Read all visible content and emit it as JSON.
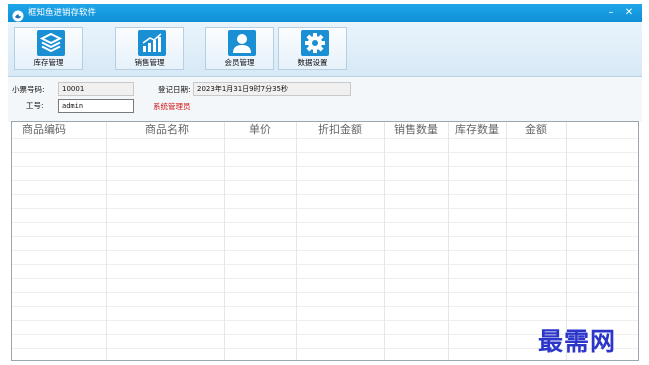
{
  "window": {
    "title": "框知鱼进销存软件",
    "minimize_glyph": "–",
    "close_glyph": "✕"
  },
  "toolbar": {
    "buttons": [
      {
        "label": "库存管理",
        "icon": "layers-icon"
      },
      {
        "label": "销售管理",
        "icon": "bar-chart-icon"
      },
      {
        "label": "会员管理",
        "icon": "person-icon"
      },
      {
        "label": "数据设置",
        "icon": "gear-icon"
      }
    ]
  },
  "form": {
    "receipt_label": "小票号码:",
    "receipt_value": "10001",
    "date_label": "登记日期:",
    "date_value": "2023年1月31日9时7分35秒",
    "staff_label": "工号:",
    "staff_value": "admin",
    "role_text": "系统管理员"
  },
  "grid": {
    "columns": [
      "商品编码",
      "商品名称",
      "单价",
      "折扣金额",
      "销售数量",
      "库存数量",
      "金额"
    ]
  },
  "watermark": "最需网",
  "colors": {
    "title_bar": "#1fa6ea",
    "icon_blue": "#1b8fd3",
    "role_red": "#d11515",
    "watermark": "#2b35c9"
  }
}
